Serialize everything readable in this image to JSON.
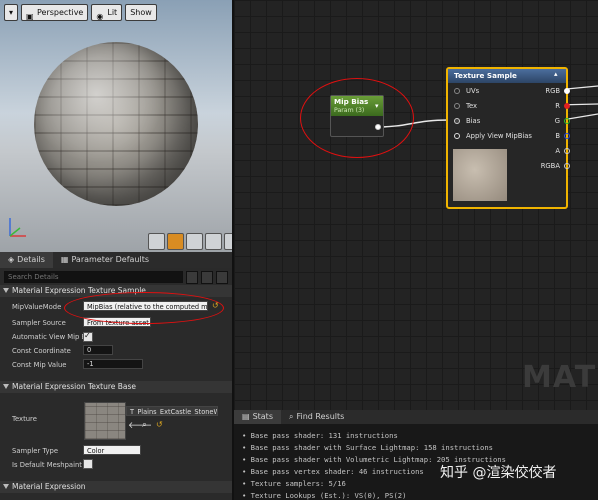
{
  "viewport": {
    "toolbar": {
      "perspective": "Perspective",
      "lit": "Lit",
      "show": "Show"
    }
  },
  "details_tabs": [
    {
      "label": "Details"
    },
    {
      "label": "Parameter Defaults"
    }
  ],
  "details": {
    "search_placeholder": "Search Details",
    "cat1": "Material Expression Texture Sample",
    "mip_label": "MipValueMode",
    "mip_value": "MipBias (relative to the computed mip",
    "sampler_source_label": "Sampler Source",
    "sampler_source_value": "From texture asset",
    "auto_mip_label": "Automatic View Mip Bi",
    "const_coord_label": "Const Coordinate",
    "const_coord_value": "0",
    "const_mip_label": "Const Mip Value",
    "const_mip_value": "-1",
    "cat2": "Material Expression Texture Base",
    "texture_label": "Texture",
    "texture_value": "T_Plains_ExtCastle_StoneW",
    "sampler_type_label": "Sampler Type",
    "sampler_type_value": "Color",
    "default_meshpaint_label": "Is Default Meshpaint T",
    "cat3": "Material Expression"
  },
  "graph": {
    "mip_node": {
      "title": "Mip Bias",
      "subtitle": "Param (3)"
    },
    "tex_node": {
      "title": "Texture Sample",
      "inputs": [
        "UVs",
        "Tex",
        "Bias",
        "Apply View MipBias"
      ],
      "outputs": [
        "RGB",
        "R",
        "G",
        "B",
        "A",
        "RGBA"
      ]
    },
    "watermark": "MATE"
  },
  "stats_tabs": [
    {
      "label": "Stats"
    },
    {
      "label": "Find Results"
    }
  ],
  "stats": [
    "Base pass shader: 131 instructions",
    "Base pass shader with Surface Lightmap: 158 instructions",
    "Base pass shader with Volumetric Lightmap: 205 instructions",
    "Base pass vertex shader: 46 instructions",
    "Texture samplers: 5/16",
    "Texture Lookups (Est.): VS(0), PS(2)"
  ],
  "credit": "知乎 @渲染佼佼者",
  "colors": {
    "accent": "#f0b400",
    "annotation": "#e01010",
    "param_green": "#6a9e38"
  }
}
